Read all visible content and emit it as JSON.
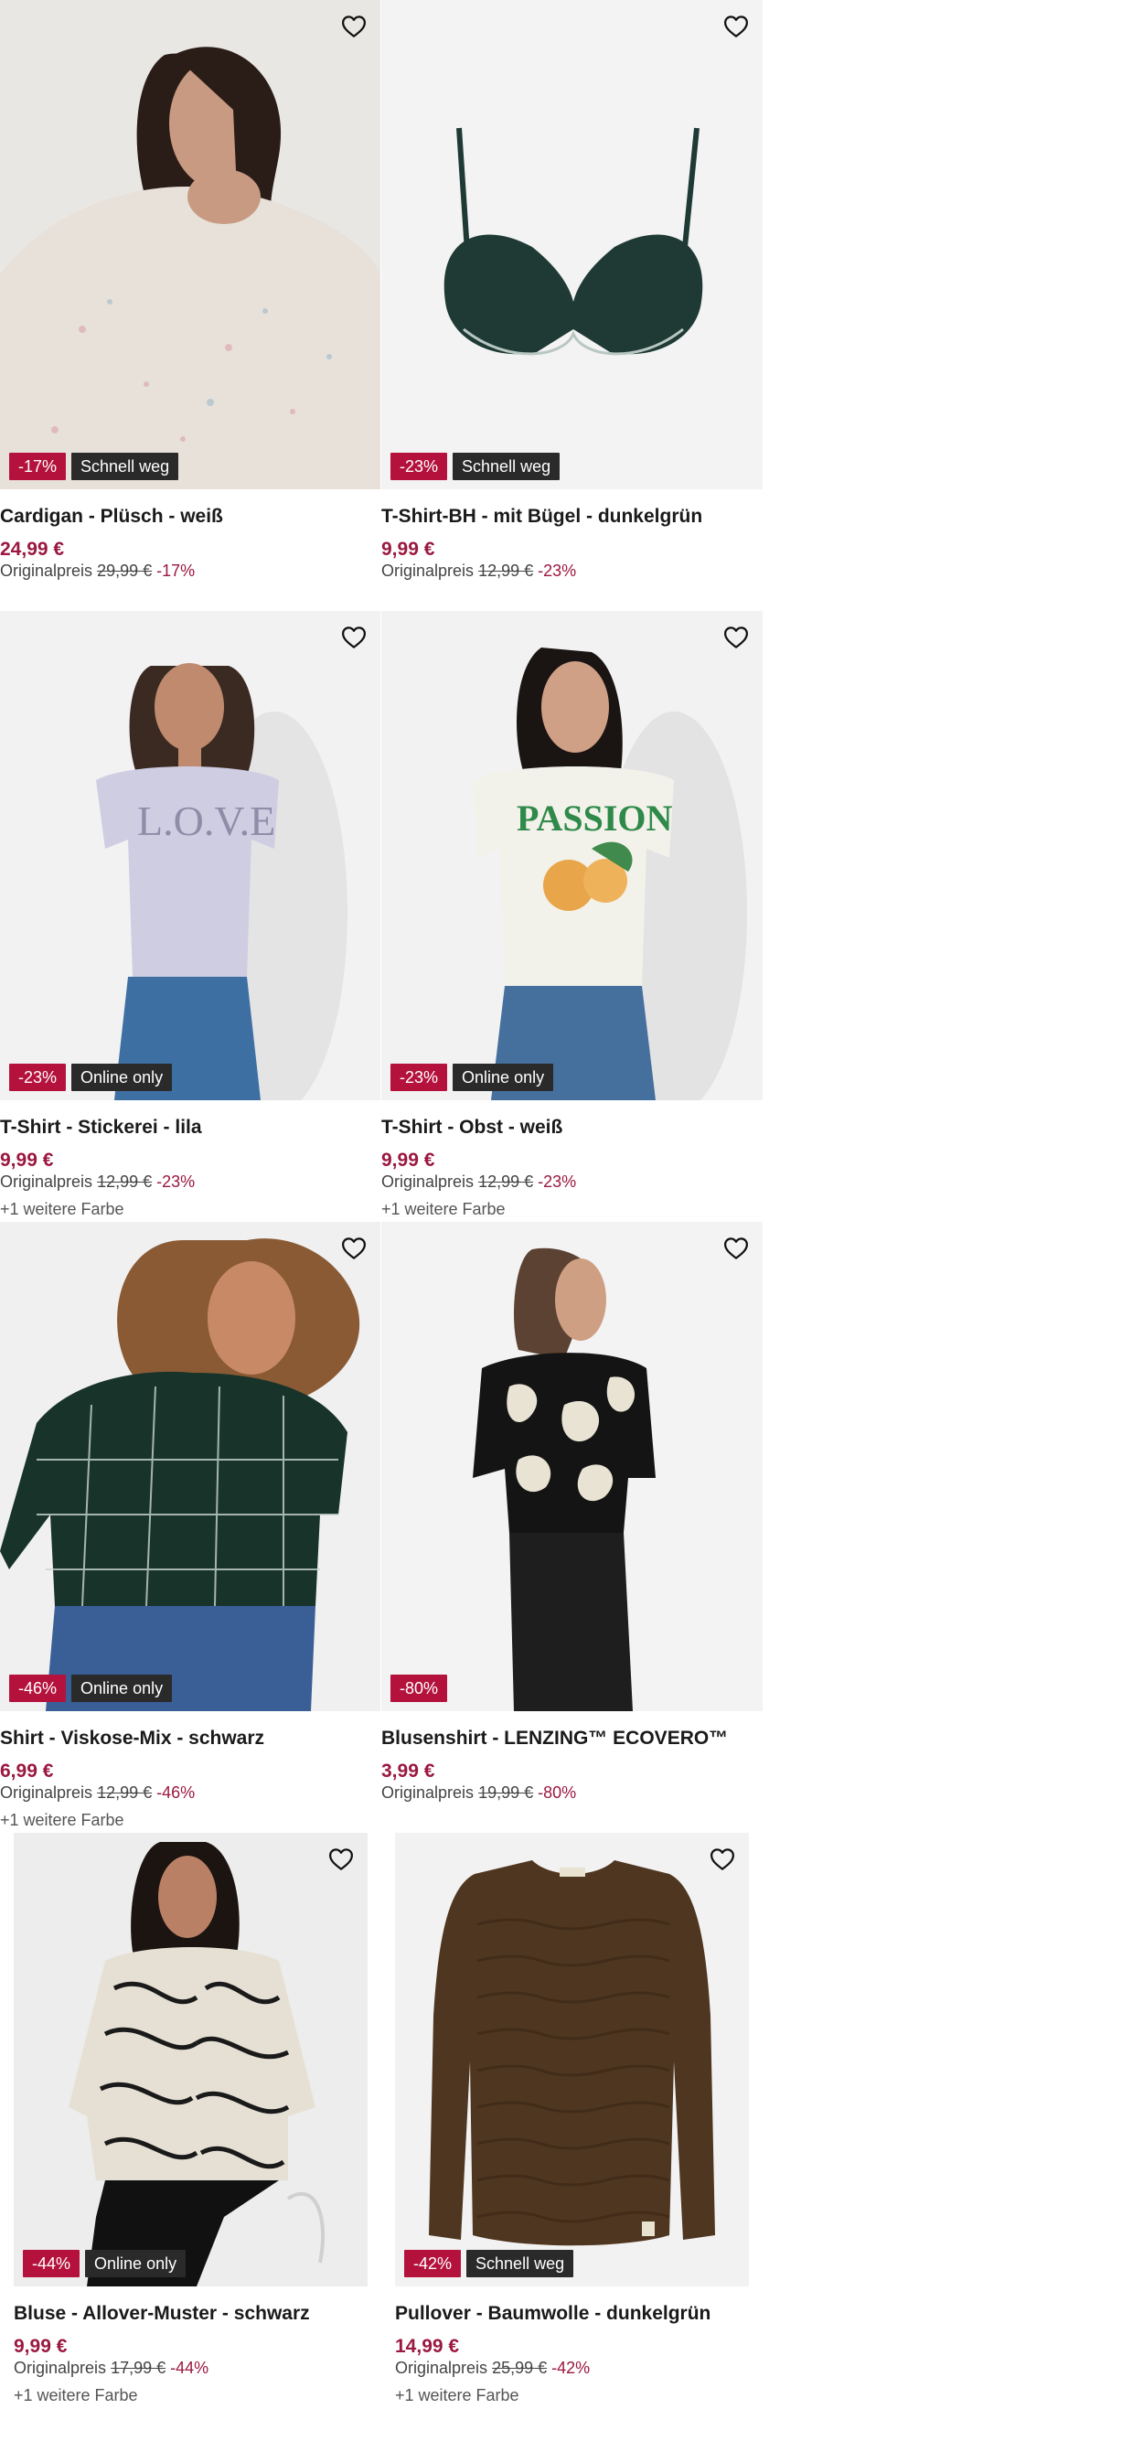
{
  "colors": {
    "accent": "#9b1840",
    "discount_badge": "#b4123c",
    "tag_badge": "#2a2a2a",
    "image_bg": "#f2f2f2"
  },
  "products": [
    {
      "title": "Cardigan - Plüsch - weiß",
      "price": "24,99 €",
      "orig_label": "Originalpreis",
      "orig_price": "29,99 €",
      "orig_pct": "-17%",
      "badge_discount": "-17%",
      "badge_tag": "Schnell weg",
      "colors_note": "",
      "icon": "heart-icon"
    },
    {
      "title": "T-Shirt-BH - mit Bügel - dunkelgrün",
      "price": "9,99 €",
      "orig_label": "Originalpreis",
      "orig_price": "12,99 €",
      "orig_pct": "-23%",
      "badge_discount": "-23%",
      "badge_tag": "Schnell weg",
      "colors_note": "",
      "icon": "heart-icon"
    },
    {
      "title": "T-Shirt - Stickerei - lila",
      "price": "9,99 €",
      "orig_label": "Originalpreis",
      "orig_price": "12,99 €",
      "orig_pct": "-23%",
      "badge_discount": "-23%",
      "badge_tag": "Online only",
      "colors_note": "+1 weitere Farbe",
      "icon": "heart-icon"
    },
    {
      "title": "T-Shirt - Obst - weiß",
      "price": "9,99 €",
      "orig_label": "Originalpreis",
      "orig_price": "12,99 €",
      "orig_pct": "-23%",
      "badge_discount": "-23%",
      "badge_tag": "Online only",
      "colors_note": "+1 weitere Farbe",
      "icon": "heart-icon"
    },
    {
      "title": "Shirt - Viskose-Mix - schwarz",
      "price": "6,99 €",
      "orig_label": "Originalpreis",
      "orig_price": "12,99 €",
      "orig_pct": "-46%",
      "badge_discount": "-46%",
      "badge_tag": "Online only",
      "colors_note": "+1 weitere Farbe",
      "icon": "heart-icon"
    },
    {
      "title": "Blusenshirt - LENZING™ ECOVERO™",
      "price": "3,99 €",
      "orig_label": "Originalpreis",
      "orig_price": "19,99 €",
      "orig_pct": "-80%",
      "badge_discount": "-80%",
      "badge_tag": "",
      "colors_note": "",
      "icon": "heart-icon"
    },
    {
      "title": "Bluse - Allover-Muster - schwarz",
      "price": "9,99 €",
      "orig_label": "Originalpreis",
      "orig_price": "17,99 €",
      "orig_pct": "-44%",
      "badge_discount": "-44%",
      "badge_tag": "Online only",
      "colors_note": "+1 weitere Farbe",
      "icon": "heart-icon"
    },
    {
      "title": "Pullover - Baumwolle - dunkelgrün",
      "price": "14,99 €",
      "orig_label": "Originalpreis",
      "orig_price": "25,99 €",
      "orig_pct": "-42%",
      "badge_discount": "-42%",
      "badge_tag": "Schnell weg",
      "colors_note": "+1 weitere Farbe",
      "icon": "heart-icon"
    }
  ]
}
